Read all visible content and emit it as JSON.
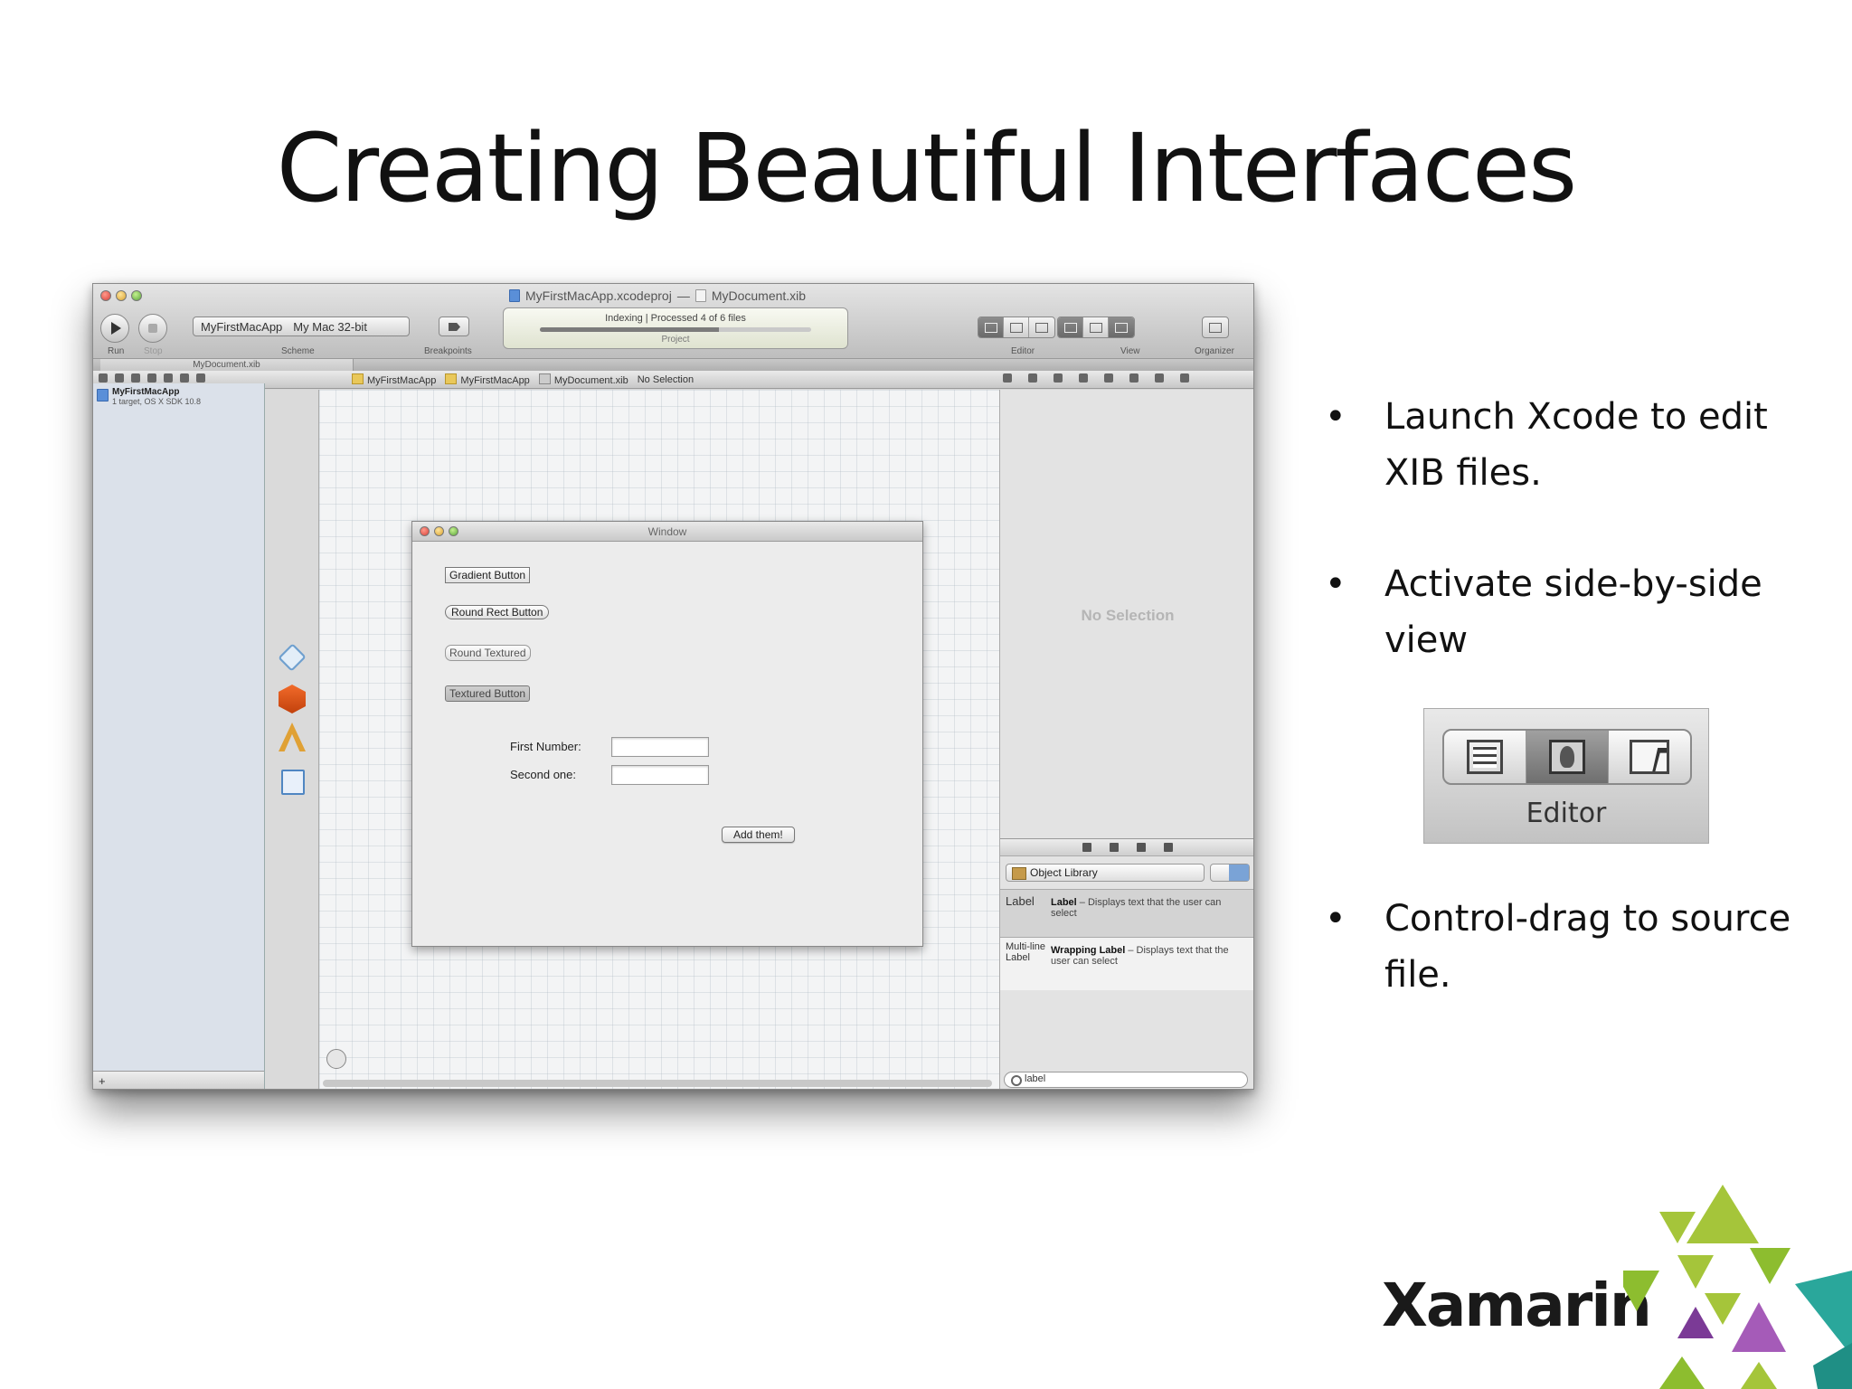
{
  "slide": {
    "title": "Creating Beautiful Interfaces",
    "bullets": [
      "Launch Xcode to edit XIB files.",
      "Activate side-by-side view",
      "Control-drag to source file."
    ]
  },
  "xcode": {
    "window_title": {
      "project": "MyFirstMacApp.xcodeproj",
      "separator": "—",
      "file": "MyDocument.xib"
    },
    "toolbar": {
      "run_label": "Run",
      "stop_label": "Stop",
      "scheme_target": "MyFirstMacApp",
      "scheme_destination": "My Mac 32-bit",
      "scheme_label": "Scheme",
      "breakpoints_label": "Breakpoints",
      "activity_status": "Indexing | Processed 4 of 6 files",
      "activity_progress": 0.66,
      "activity_project": "Project",
      "editor_label": "Editor",
      "view_label": "View",
      "organizer_label": "Organizer"
    },
    "tab": "MyDocument.xib",
    "jump_bar": [
      "MyFirstMacApp",
      "MyFirstMacApp",
      "MyDocument.xib",
      "No Selection"
    ],
    "navigator": {
      "project_name": "MyFirstMacApp",
      "project_subtitle": "1 target, OS X SDK 10.8"
    },
    "ib_window": {
      "title": "Window",
      "gradient_button": "Gradient Button",
      "round_rect_button": "Round Rect Button",
      "round_textured_button": "Round Textured",
      "textured_button": "Textured Button",
      "first_number_label": "First Number:",
      "second_label": "Second one:",
      "add_button": "Add them!"
    },
    "inspector": {
      "no_selection": "No Selection"
    },
    "library": {
      "selector": "Object Library",
      "items": [
        {
          "sample": "Label",
          "name": "Label",
          "desc": " – Displays text that the user can select"
        },
        {
          "sample": "Multi-line Label",
          "name": "Wrapping Label",
          "desc": " – Displays text that the user can select"
        }
      ],
      "search_value": "label"
    }
  },
  "editor_widget": {
    "caption": "Editor"
  },
  "logo": {
    "wordmark": "Xamarin",
    "colors": [
      "#a5c53a",
      "#8dbd2f",
      "#7b3a96",
      "#a55bb8",
      "#2aa79b",
      "#1f8f85"
    ]
  }
}
